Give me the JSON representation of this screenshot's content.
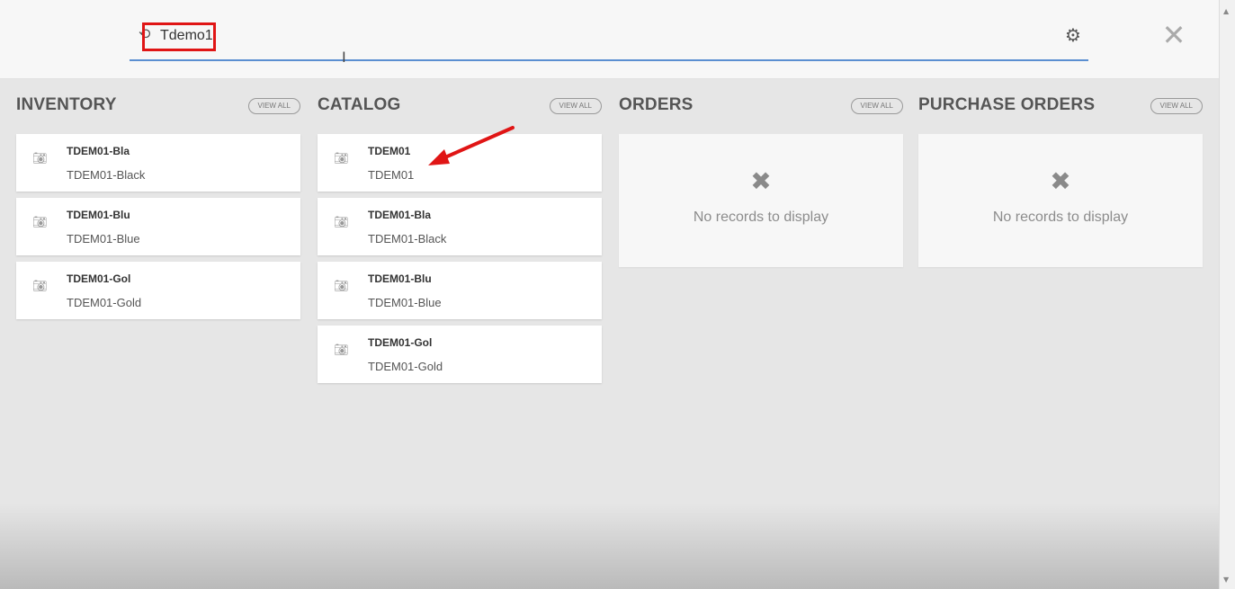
{
  "search": {
    "value": "Tdemo1",
    "icon": "history-icon"
  },
  "toolbar": {
    "settings_icon": "gear-icon",
    "close_icon": "close-icon"
  },
  "columns": [
    {
      "title": "INVENTORY",
      "view_all": "VIEW ALL",
      "items": [
        {
          "code": "TDEM01-Bla",
          "name": "TDEM01-Black"
        },
        {
          "code": "TDEM01-Blu",
          "name": "TDEM01-Blue"
        },
        {
          "code": "TDEM01-Gol",
          "name": "TDEM01-Gold"
        }
      ]
    },
    {
      "title": "CATALOG",
      "view_all": "VIEW ALL",
      "items": [
        {
          "code": "TDEM01",
          "name": "TDEM01"
        },
        {
          "code": "TDEM01-Bla",
          "name": "TDEM01-Black"
        },
        {
          "code": "TDEM01-Blu",
          "name": "TDEM01-Blue"
        },
        {
          "code": "TDEM01-Gol",
          "name": "TDEM01-Gold"
        }
      ]
    },
    {
      "title": "ORDERS",
      "view_all": "VIEW ALL",
      "empty_text": "No records to display"
    },
    {
      "title": "PURCHASE ORDERS",
      "view_all": "VIEW ALL",
      "empty_text": "No records to display"
    }
  ],
  "colors": {
    "accent_underline": "#5b8fd1",
    "annotation_red": "#e01515"
  }
}
